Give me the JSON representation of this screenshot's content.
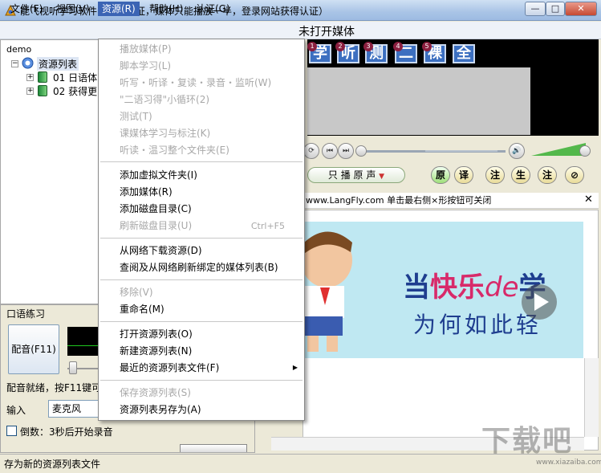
{
  "window": {
    "title": "能飞视听学习软件（未经认证，媒体只能播放一半，登录网站获得认证）",
    "minimize": "—",
    "maximize": "□",
    "close": "✕"
  },
  "menubar": {
    "file": "文件(F)",
    "view": "视图(V)",
    "resource": "资源(R)",
    "help": "帮助(H)",
    "auth": "认证(G)"
  },
  "media_status": "未打开媒体",
  "tree": {
    "header": "demo",
    "root": "资源列表",
    "items": [
      "01 日语体",
      "02 获得更"
    ]
  },
  "subtitle_buttons": [
    {
      "num": "1",
      "label": "学"
    },
    {
      "num": "2",
      "label": "听"
    },
    {
      "num": "3",
      "label": "测"
    },
    {
      "num": "4",
      "label": "二"
    },
    {
      "num": "5",
      "label": "裸"
    },
    {
      "num": "",
      "label": "全"
    }
  ],
  "player": {
    "play_mode": "只 播 原 声",
    "mode_buttons": [
      "原",
      "译",
      "注",
      "生",
      "注",
      "⊘"
    ]
  },
  "ad_bar": "www.LangFly.com 单击最右侧×形按钮可关闭",
  "banner": {
    "line1_a": "当",
    "line1_b": "快乐",
    "line1_c": "de",
    "line1_d": "学",
    "line2": "为何如此轻"
  },
  "oral": {
    "title": "口语练习",
    "dub_button": "配音(F11)",
    "status": "配音就绪，按F11键可",
    "input_label": "输入",
    "input_value": "麦克风",
    "countdown": "倒数：3秒后开始录音"
  },
  "dropdown": {
    "items": [
      {
        "label": "播放媒体(P)",
        "disabled": true
      },
      {
        "label": "脚本学习(L)",
        "disabled": true
      },
      {
        "label": "听写・听译・复读・录音・监听(W)",
        "disabled": true
      },
      {
        "label": "\"二语习得\"小循环(2)",
        "disabled": true
      },
      {
        "label": "测试(T)",
        "disabled": true
      },
      {
        "label": "课媒体学习与标注(K)",
        "disabled": true
      },
      {
        "label": "听读・温习整个文件夹(E)",
        "disabled": true
      },
      {
        "label": "添加虚拟文件夹(I)",
        "disabled": false
      },
      {
        "label": "添加媒体(R)",
        "disabled": false
      },
      {
        "label": "添加磁盘目录(C)",
        "disabled": false
      },
      {
        "label": "刷新磁盘目录(U)",
        "disabled": true,
        "shortcut": "Ctrl+F5"
      },
      {
        "label": "从网络下载资源(D)",
        "disabled": false
      },
      {
        "label": "查阅及从网络刷新绑定的媒体列表(B)",
        "disabled": false
      },
      {
        "label": "移除(V)",
        "disabled": true
      },
      {
        "label": "重命名(M)",
        "disabled": false
      },
      {
        "label": "打开资源列表(O)",
        "disabled": false
      },
      {
        "label": "新建资源列表(N)",
        "disabled": false
      },
      {
        "label": "最近的资源列表文件(F)",
        "disabled": false,
        "submenu": true
      },
      {
        "label": "保存资源列表(S)",
        "disabled": true
      },
      {
        "label": "资源列表另存为(A)",
        "disabled": false
      }
    ]
  },
  "statusbar": "存为新的资源列表文件",
  "watermark": {
    "logo": "下载吧",
    "url": "www.xiazaiba.com"
  },
  "colors": {
    "menu_highlight": "#3b64b4",
    "video_bg": "#000000",
    "banner_bg": "#bfe8f2"
  }
}
